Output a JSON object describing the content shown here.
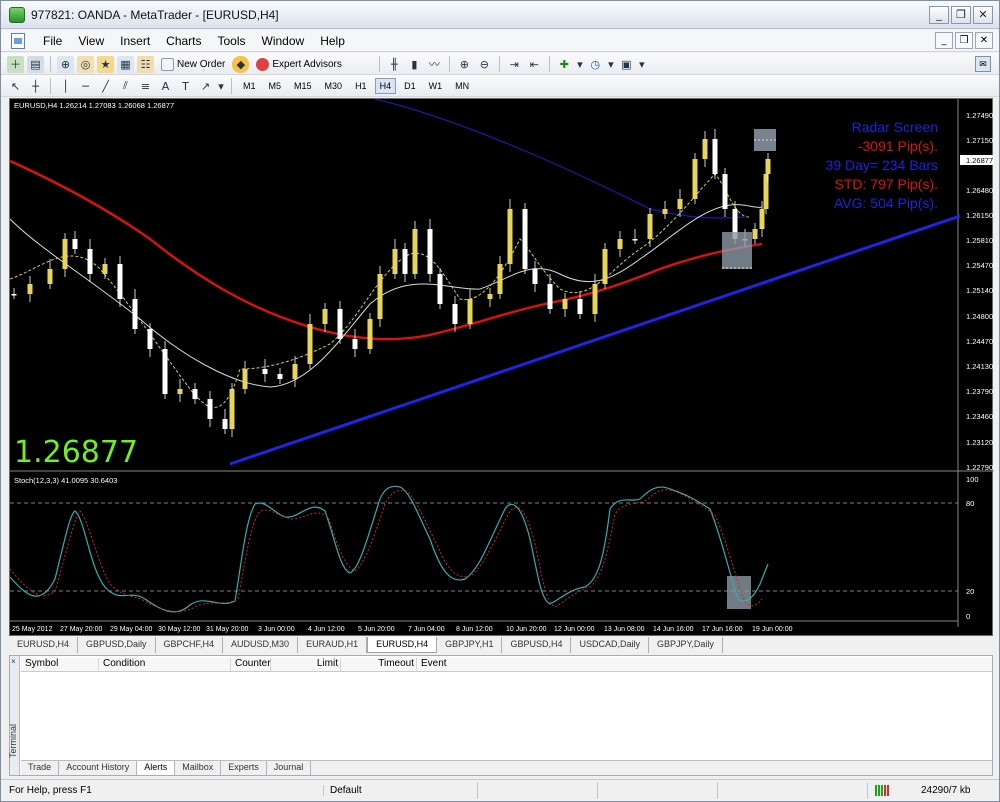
{
  "window": {
    "title": "977821: OANDA - MetaTrader - [EURUSD,H4]",
    "minimize": "_",
    "restore": "❐",
    "close": "✕"
  },
  "menu": {
    "items": [
      "File",
      "View",
      "Insert",
      "Charts",
      "Tools",
      "Window",
      "Help"
    ]
  },
  "toolbar": {
    "new_order": "New Order",
    "expert_advisors": "Expert Advisors",
    "timeframes": [
      "M1",
      "M5",
      "M15",
      "M30",
      "H1",
      "H4",
      "D1",
      "W1",
      "MN"
    ],
    "active_timeframe": "H4"
  },
  "chart": {
    "header": "EURUSD,H4  1.26214 1.27083 1.26068 1.26877",
    "big_price": "1.26877",
    "price_labels": [
      "1.27490",
      "1.27150",
      "1.26877",
      "1.26480",
      "1.26150",
      "1.25810",
      "1.25470",
      "1.25140",
      "1.24800",
      "1.24470",
      "1.24130",
      "1.23790",
      "1.23460",
      "1.23120",
      "1.22790"
    ],
    "radar": {
      "title": "Radar Screen",
      "pips": "-3091 Pip(s).",
      "bars": "39 Day= 234 Bars",
      "std": "STD: 797 Pip(s).",
      "avg": "AVG: 504 Pip(s)."
    },
    "stoch_header": "Stoch(12,3,3) 41.0095 30.6403",
    "stoch_labels": [
      "100",
      "80",
      "20",
      "0"
    ],
    "time_labels": [
      "25 May 2012",
      "27 May 20:00",
      "29 May 04:00",
      "30 May 12:00",
      "31 May 20:00",
      "3 Jun 00:00",
      "4 Jun 12:00",
      "5 Jun 20:00",
      "7 Jun 04:00",
      "8 Jun 12:00",
      "10 Jun 20:00",
      "12 Jun 00:00",
      "13 Jun 08:00",
      "14 Jun 16:00",
      "17 Jun 16:00",
      "19 Jun 00:00"
    ],
    "colors": {
      "bull": "#e8d458",
      "bear": "#ffffff",
      "ma_red": "#e01010",
      "trend_blue": "#2020e0",
      "stoch_main": "#30b0b0",
      "stoch_signal": "#e02020",
      "green_price": "#70f020"
    }
  },
  "chart_tabs": [
    "EURUSD,H4",
    "GBPUSD,Daily",
    "GBPCHF,H4",
    "AUDUSD,M30",
    "EURAUD,H1",
    "EURUSD,H4",
    "GBPJPY,H1",
    "GBPUSD,H4",
    "USDCAD,Daily",
    "GBPJPY,Daily"
  ],
  "chart_tabs_active": 5,
  "terminal": {
    "side_label": "Terminal",
    "close": "×",
    "columns": [
      "Symbol",
      "Condition",
      "Counter",
      "Limit",
      "Timeout",
      "Event"
    ],
    "tabs": [
      "Trade",
      "Account History",
      "Alerts",
      "Mailbox",
      "Experts",
      "Journal"
    ],
    "active_tab": 2
  },
  "status": {
    "help": "For Help, press F1",
    "profile": "Default",
    "traffic": "24290/7 kb"
  }
}
